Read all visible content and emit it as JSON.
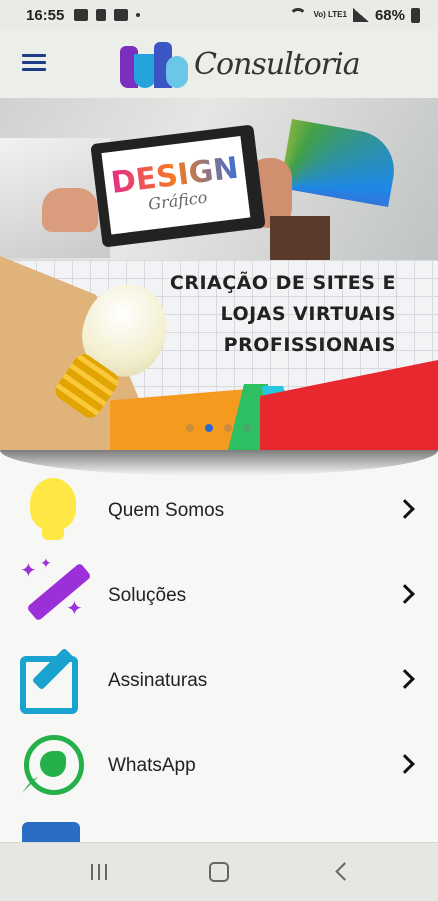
{
  "status_bar": {
    "time": "16:55",
    "lte": "Vo) LTE1",
    "battery": "68%"
  },
  "header": {
    "logo_mark": "UB",
    "logo_text": "Consultoria"
  },
  "banner": {
    "tablet_title": "DESIGN",
    "tablet_subtitle": "Gráfico",
    "headline": [
      "CRIAÇÃO DE SITES E",
      "LOJAS VIRTUAIS",
      "PROFISSIONAIS"
    ],
    "carousel_dots": 4,
    "active_dot_index": 1
  },
  "menu": {
    "items": [
      {
        "label": "Quem Somos",
        "icon": "lightbulb-icon"
      },
      {
        "label": "Soluções",
        "icon": "magic-wand-icon"
      },
      {
        "label": "Assinaturas",
        "icon": "edit-icon"
      },
      {
        "label": "WhatsApp",
        "icon": "whatsapp-icon"
      }
    ]
  },
  "colors": {
    "accent_blue": "#2b68d6",
    "whatsapp_green": "#25b04a",
    "bulb_yellow": "#ffe845",
    "wand_purple": "#9b2fd8",
    "edit_blue": "#1aa3cf",
    "banner_red": "#e8282f"
  },
  "nav_bar": {
    "recent_icon": "recent-apps-icon",
    "home_icon": "home-icon",
    "back_icon": "back-icon"
  }
}
